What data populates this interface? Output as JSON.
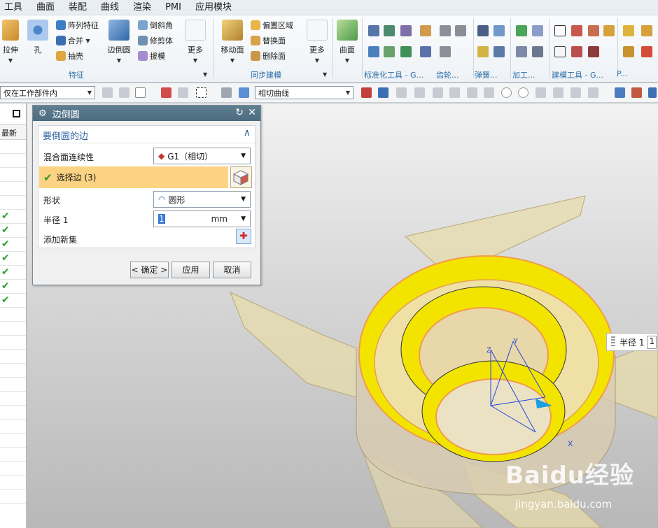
{
  "menubar": {
    "items": [
      "工具",
      "曲面",
      "装配",
      "曲线",
      "渲染",
      "PMI",
      "应用模块"
    ]
  },
  "ribbon": {
    "feature": {
      "extrude": "拉伸",
      "hole": "孔",
      "pattern": "阵列特征",
      "unite": "合并",
      "shell": "抽壳",
      "edge_blend": "边倒圆",
      "chamfer": "倒斜角",
      "trim_body": "修剪体",
      "draft": "拔模",
      "more": "更多",
      "group": "特征"
    },
    "sync": {
      "move_face": "移动面",
      "offset_region": "偏置区域",
      "replace_face": "替换面",
      "delete_face": "删除面",
      "more": "更多",
      "group": "同步建模"
    },
    "surface": {
      "label": "曲面"
    },
    "groups": {
      "std_tools": "标准化工具 - G...",
      "gear": "齿轮...",
      "spring": "弹簧...",
      "machining": "加工...",
      "modeling_tools": "建模工具 - G...",
      "p": "P..."
    }
  },
  "toolbar": {
    "filter_scope": "仅在工作部件内",
    "curve_rule": "相切曲线"
  },
  "navigator": {
    "column_header": "最新",
    "checked_rows": 7
  },
  "dialog": {
    "title": "边倒圆",
    "section": "要倒圆的边",
    "continuity_label": "混合面连续性",
    "continuity_value": "G1（相切）",
    "select_edge": "选择边 (3)",
    "shape_label": "形状",
    "shape_value": "圆形",
    "radius_label": "半径 1",
    "radius_value": "1",
    "radius_unit": "mm",
    "add_set": "添加新集",
    "ok": "< 确定 >",
    "apply": "应用",
    "cancel": "取消"
  },
  "viewport": {
    "radius_tip_label": "半径 1",
    "radius_tip_value": "1",
    "axis_x": "X",
    "axis_y": "Y",
    "axis_z": "Z"
  },
  "watermark": {
    "brand": "Baidu经验",
    "url": "jingyan.baidu.com"
  },
  "colors": {
    "ribbon_group_text": "#2a6ea8",
    "selection_highlight": "#fbd382",
    "fillet_yellow": "#f3e400",
    "part_tan": "#e8dca8",
    "edge_orange": "#f29a4b"
  }
}
